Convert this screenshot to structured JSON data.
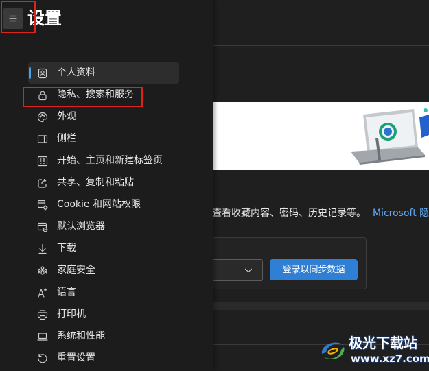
{
  "page": {
    "title": "设置"
  },
  "menu_button": {
    "icon": "hamburger-icon"
  },
  "sidebar": {
    "items": [
      {
        "label": "个人资料",
        "icon": "profile-icon",
        "selected": true
      },
      {
        "label": "隐私、搜索和服务",
        "icon": "lock-icon",
        "selected": false
      },
      {
        "label": "外观",
        "icon": "palette-icon",
        "selected": false
      },
      {
        "label": "侧栏",
        "icon": "sidebar-icon",
        "selected": false
      },
      {
        "label": "开始、主页和新建标签页",
        "icon": "start-page-icon",
        "selected": false
      },
      {
        "label": "共享、复制和粘贴",
        "icon": "share-icon",
        "selected": false
      },
      {
        "label": "Cookie 和网站权限",
        "icon": "site-permissions-icon",
        "selected": false
      },
      {
        "label": "默认浏览器",
        "icon": "default-browser-icon",
        "selected": false
      },
      {
        "label": "下载",
        "icon": "download-icon",
        "selected": false
      },
      {
        "label": "家庭安全",
        "icon": "family-icon",
        "selected": false
      },
      {
        "label": "语言",
        "icon": "language-icon",
        "selected": false
      },
      {
        "label": "打印机",
        "icon": "printer-icon",
        "selected": false
      },
      {
        "label": "系统和性能",
        "icon": "laptop-icon",
        "selected": false
      },
      {
        "label": "重置设置",
        "icon": "reset-icon",
        "selected": false
      }
    ]
  },
  "main": {
    "sync_description": "查看收藏内容、密码、历史记录等。",
    "privacy_link": "Microsoft 隐",
    "account_dropdown": {
      "icon": "chevron-down-icon"
    },
    "sync_button_label": "登录以同步数据"
  },
  "watermark": {
    "site_name": "极光下载站",
    "url": "www.xz7.com"
  },
  "colors": {
    "background": "#1f1f1f",
    "sidebar": "#1c1c1c",
    "selected_item": "#2d2d2d",
    "accent": "#4ca0e8",
    "primary_button": "#2f7fd4",
    "link": "#5fa9f2",
    "annotation_box": "#e0221f",
    "text": "#e8e8e8"
  }
}
